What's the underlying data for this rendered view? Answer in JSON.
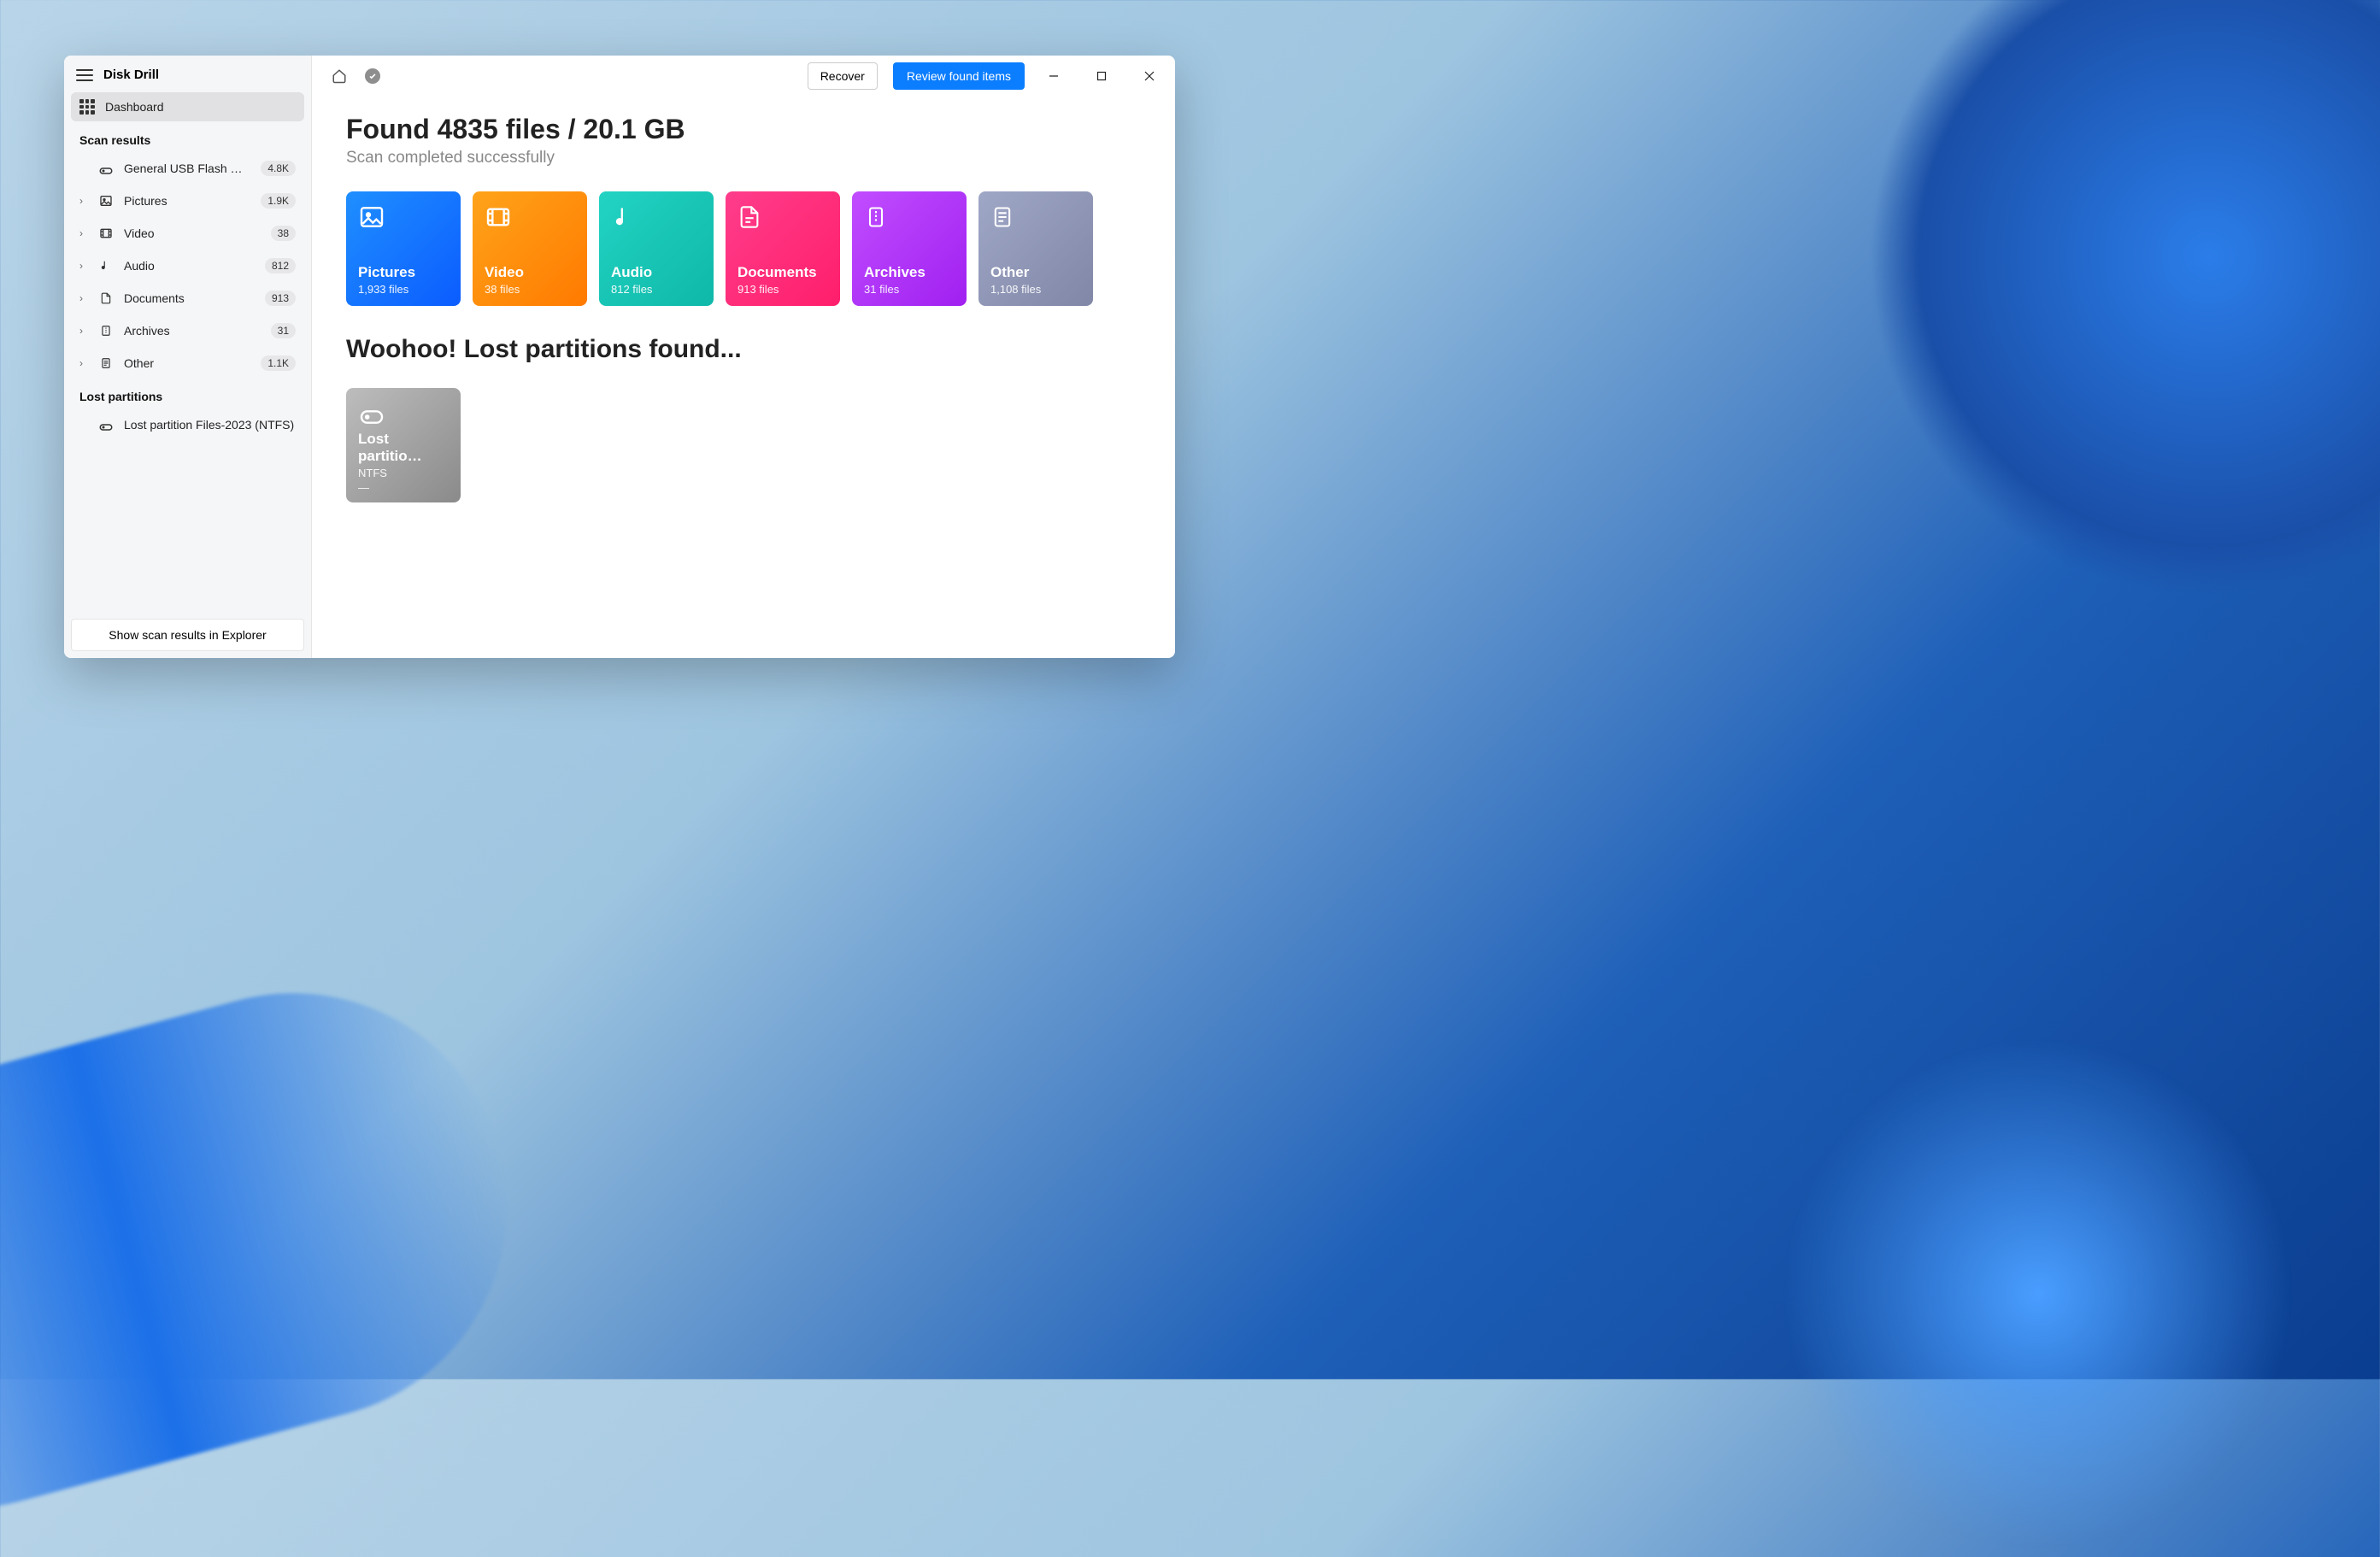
{
  "app": {
    "title": "Disk Drill"
  },
  "sidebar": {
    "dashboard_label": "Dashboard",
    "scan_results_heading": "Scan results",
    "lost_partitions_heading": "Lost partitions",
    "explorer_button": "Show scan results in Explorer",
    "device": {
      "label": "General USB Flash Disk…",
      "badge": "4.8K"
    },
    "items": [
      {
        "label": "Pictures",
        "badge": "1.9K"
      },
      {
        "label": "Video",
        "badge": "38"
      },
      {
        "label": "Audio",
        "badge": "812"
      },
      {
        "label": "Documents",
        "badge": "913"
      },
      {
        "label": "Archives",
        "badge": "31"
      },
      {
        "label": "Other",
        "badge": "1.1K"
      }
    ],
    "lost_partition_item": "Lost partition Files-2023 (NTFS)"
  },
  "titlebar": {
    "recover": "Recover",
    "review": "Review found items"
  },
  "summary": {
    "headline": "Found 4835 files / 20.1 GB",
    "subhead": "Scan completed successfully"
  },
  "cards": [
    {
      "title": "Pictures",
      "sub": "1,933 files"
    },
    {
      "title": "Video",
      "sub": "38 files"
    },
    {
      "title": "Audio",
      "sub": "812 files"
    },
    {
      "title": "Documents",
      "sub": "913 files"
    },
    {
      "title": "Archives",
      "sub": "31 files"
    },
    {
      "title": "Other",
      "sub": "1,108 files"
    }
  ],
  "partitions": {
    "heading": "Woohoo! Lost partitions found...",
    "card": {
      "title": "Lost partitio…",
      "fs": "NTFS",
      "size": "—"
    }
  }
}
